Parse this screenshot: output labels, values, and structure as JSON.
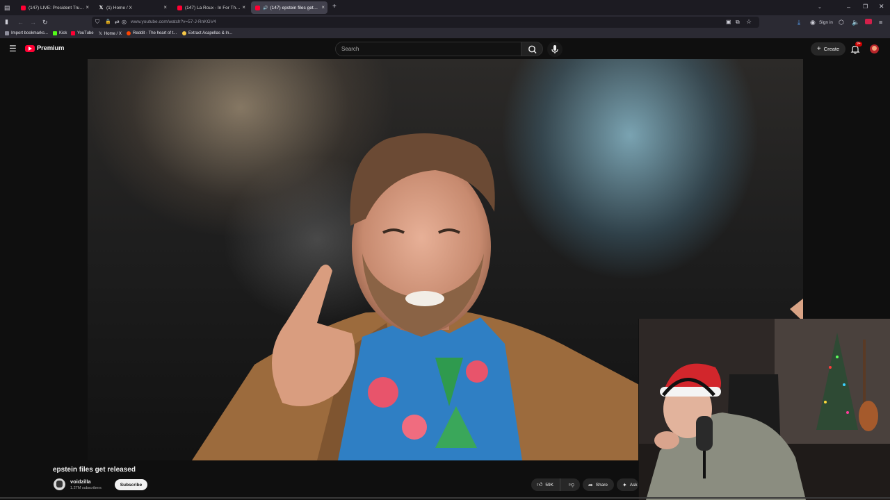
{
  "browser": {
    "tabs": [
      {
        "label": "(147) LIVE: President Trump m",
        "icon": "youtube-favicon",
        "active": false
      },
      {
        "label": "(1) Home / X",
        "icon": "x-favicon",
        "active": false
      },
      {
        "label": "(147) La Roux - In For The Kill (",
        "icon": "youtube-favicon",
        "active": false
      },
      {
        "label": "(147) epstein files get relea",
        "icon": "youtube-favicon",
        "active": true
      }
    ],
    "new_tab": "+",
    "url": "www.youtube.com/watch?v=57-J-RnKGV4",
    "sign_in": "Sign in",
    "bookmarks": [
      {
        "label": "Import bookmarks...",
        "icon": "folder-icon"
      },
      {
        "label": "Kick",
        "icon": "kick-favicon"
      },
      {
        "label": "YouTube",
        "icon": "youtube-favicon"
      },
      {
        "label": "Home / X",
        "icon": "x-favicon"
      },
      {
        "label": "Reddit - The heart of t...",
        "icon": "reddit-favicon"
      },
      {
        "label": "Extract Acapellas & In...",
        "icon": "emoji-favicon"
      }
    ]
  },
  "youtube": {
    "logo_text": "Premium",
    "search_placeholder": "Search",
    "create_label": "Create",
    "notification_count": "9+",
    "video_title": "epstein files get released",
    "channel_name": "voidzilla",
    "subscribers": "1.27M subscribers",
    "subscribe_label": "Subscribe",
    "likes": "59K",
    "share_label": "Share",
    "ask_label": "Ask"
  },
  "colors": {
    "youtube_red": "#ff0033",
    "background": "#0f0f0f"
  }
}
